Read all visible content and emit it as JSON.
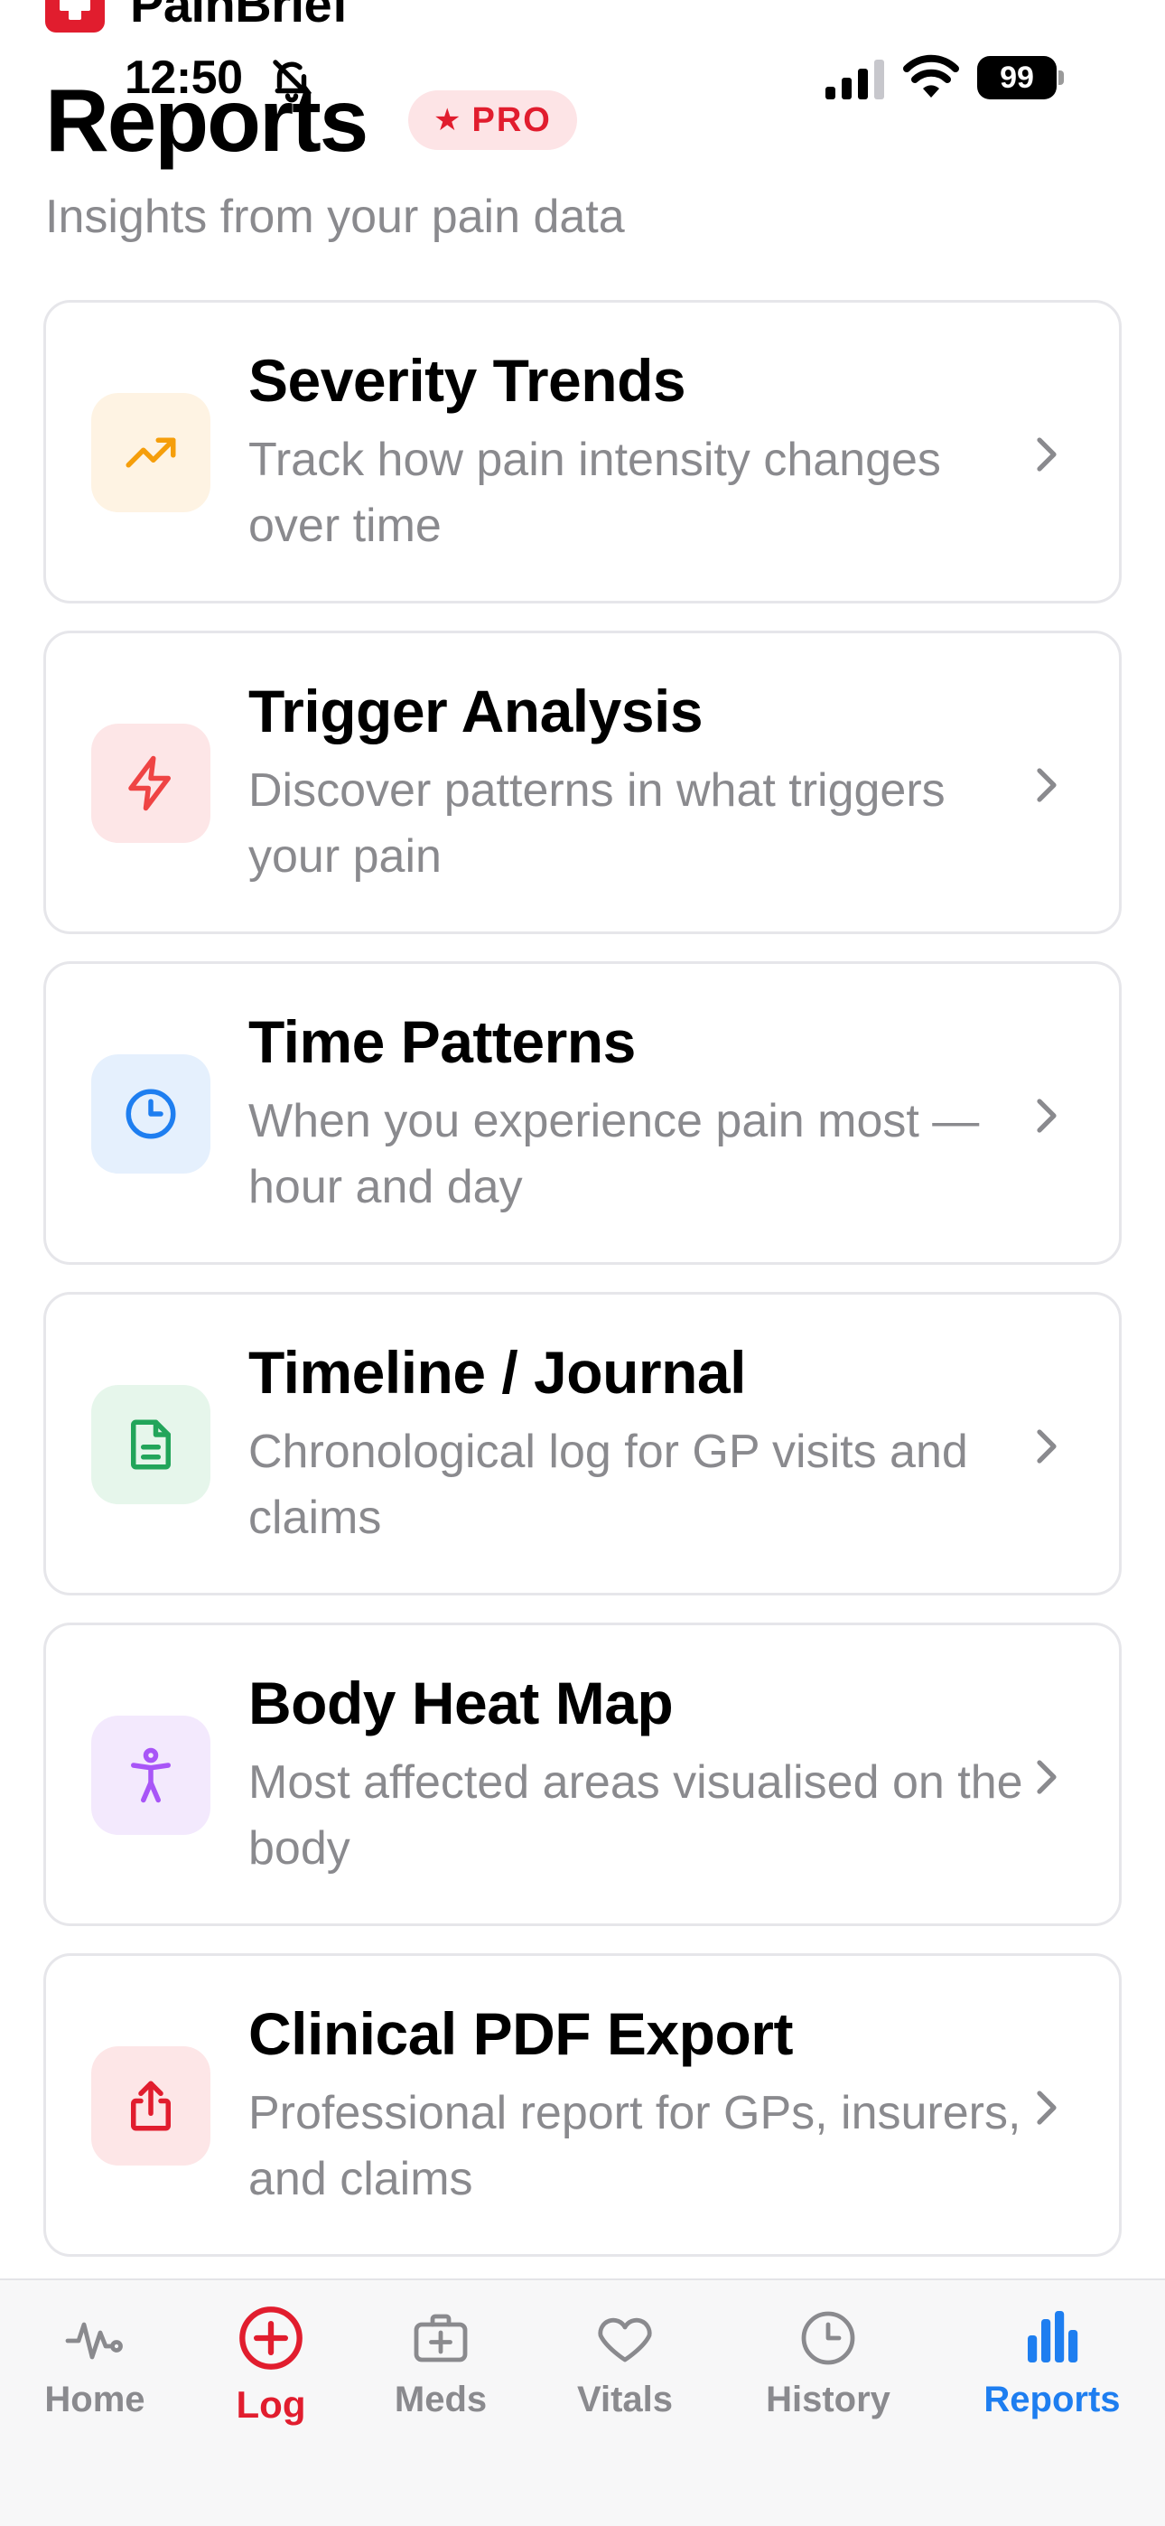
{
  "brand": {
    "name": "PainBrief"
  },
  "status_bar": {
    "time": "12:50",
    "battery": "99"
  },
  "header": {
    "title": "Reports",
    "badge": "PRO",
    "subtitle": "Insights from your pain data"
  },
  "reports": [
    {
      "title": "Severity Trends",
      "desc": "Track how pain intensity changes over time",
      "icon": "trend-up-icon",
      "color": "#f59e0b",
      "bg": "#fef3e3"
    },
    {
      "title": "Trigger Analysis",
      "desc": "Discover patterns in what triggers your pain",
      "icon": "lightning-icon",
      "color": "#ef4444",
      "bg": "#fde6e7"
    },
    {
      "title": "Time Patterns",
      "desc": "When you experience pain most — hour and day",
      "icon": "clock-icon",
      "color": "#1e7ef0",
      "bg": "#e5f0fd"
    },
    {
      "title": "Timeline / Journal",
      "desc": "Chronological log for GP visits and claims",
      "icon": "document-icon",
      "color": "#22a55a",
      "bg": "#e6f6eb"
    },
    {
      "title": "Body Heat Map",
      "desc": "Most affected areas visualised on the body",
      "icon": "body-icon",
      "color": "#a855f7",
      "bg": "#f3e9fd"
    },
    {
      "title": "Clinical PDF Export",
      "desc": "Professional report for GPs, insurers, and claims",
      "icon": "share-icon",
      "color": "#e11d2e",
      "bg": "#fde6e7"
    }
  ],
  "tabs": [
    {
      "label": "Home",
      "icon": "pulse-icon"
    },
    {
      "label": "Log",
      "icon": "plus-circle-icon"
    },
    {
      "label": "Meds",
      "icon": "medkit-icon"
    },
    {
      "label": "Vitals",
      "icon": "heart-icon"
    },
    {
      "label": "History",
      "icon": "clock-icon"
    },
    {
      "label": "Reports",
      "icon": "bar-chart-icon",
      "active": true
    }
  ],
  "colors": {
    "accent": "#e11d2e",
    "active_tab": "#1e7ef0",
    "muted": "#8a8a8e"
  }
}
